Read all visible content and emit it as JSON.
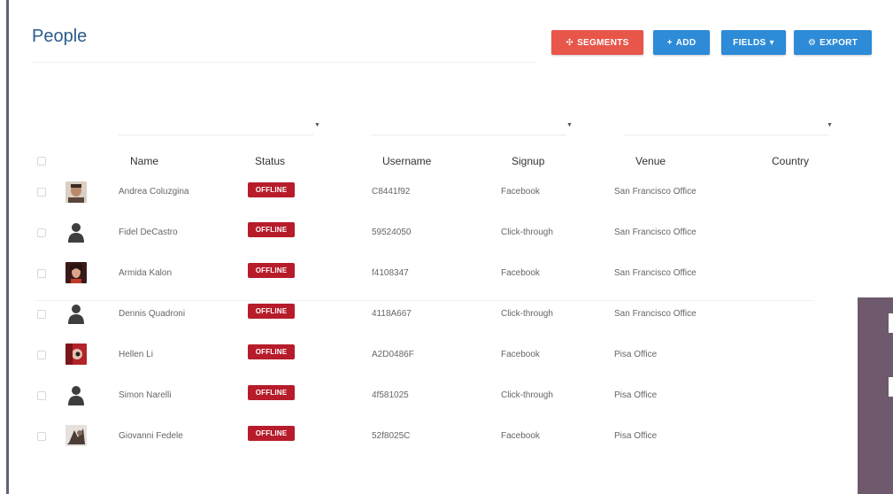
{
  "page": {
    "title": "People"
  },
  "toolbar": {
    "segments_label": "SEGMENTS",
    "add_label": "ADD",
    "fields_label": "FIELDS",
    "export_label": "EXPORT"
  },
  "table": {
    "columns": [
      "Name",
      "Status",
      "Username",
      "Signup",
      "Venue",
      "Country"
    ],
    "rows": [
      {
        "name": "Andrea Coluzgina",
        "status": "OFFLINE",
        "username": "C8441f92",
        "signup": "Facebook",
        "venue": "San Francisco Office",
        "country": ""
      },
      {
        "name": "Fidel DeCastro",
        "status": "OFFLINE",
        "username": "59524050",
        "signup": "Click-through",
        "venue": "San Francisco Office",
        "country": ""
      },
      {
        "name": "Armida Kalon",
        "status": "OFFLINE",
        "username": "f4108347",
        "signup": "Facebook",
        "venue": "San Francisco Office",
        "country": ""
      },
      {
        "name": "Dennis Quadroni",
        "status": "OFFLINE",
        "username": "4118A667",
        "signup": "Click-through",
        "venue": "San Francisco Office",
        "country": ""
      },
      {
        "name": "Hellen Li",
        "status": "OFFLINE",
        "username": "A2D0486F",
        "signup": "Facebook",
        "venue": "Pisa Office",
        "country": ""
      },
      {
        "name": "Simon Narelli",
        "status": "OFFLINE",
        "username": "4f581025",
        "signup": "Click-through",
        "venue": "Pisa Office",
        "country": ""
      },
      {
        "name": "Giovanni Fedele",
        "status": "OFFLINE",
        "username": "52f8025C",
        "signup": "Facebook",
        "venue": "Pisa Office",
        "country": ""
      }
    ]
  },
  "colors": {
    "accent_blue": "#2d8bd8",
    "segments_red": "#e8564a",
    "offline_red": "#b71c2b",
    "title_blue": "#2b5b8a"
  },
  "icons": {
    "segments": "crosshair-icon",
    "add": "plus-icon",
    "fields": "chevron-down-icon",
    "export": "gear-icon"
  }
}
